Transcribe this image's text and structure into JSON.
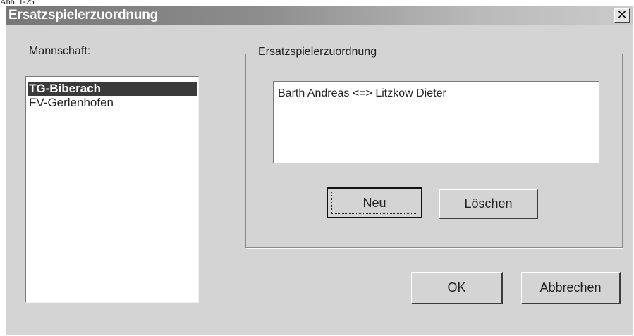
{
  "figure_label": "Abb. 1-25",
  "window": {
    "title": "Ersatzspielerzuordnung",
    "close_symbol": "✕"
  },
  "teams": {
    "label": "Mannschaft:",
    "items": [
      "TG-Biberach",
      "FV-Gerlenhofen"
    ],
    "selected": "TG-Biberach"
  },
  "assignment": {
    "group_label": "Ersatzspielerzuordnung",
    "items": [
      "Barth Andreas <=> Litzkow Dieter"
    ],
    "new_label": "Neu",
    "delete_label": "Löschen"
  },
  "footer": {
    "ok_label": "OK",
    "cancel_label": "Abbrechen"
  }
}
